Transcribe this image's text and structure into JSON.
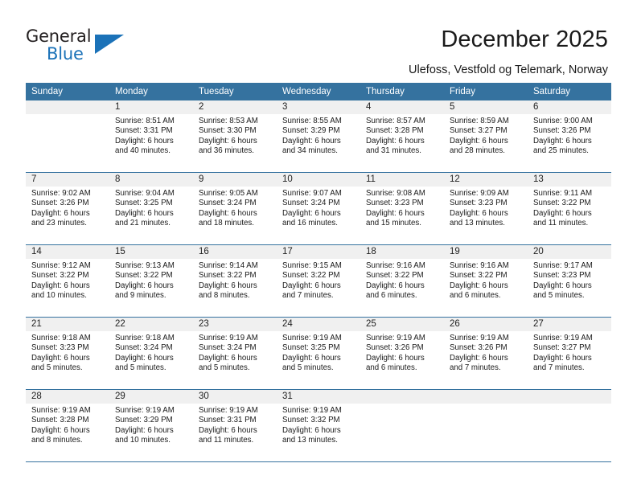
{
  "brand": {
    "name_top": "General",
    "name_bottom": "Blue",
    "accent_color": "#1b72b8",
    "triangle_icon": "triangle-icon"
  },
  "header": {
    "title": "December 2025",
    "subtitle": "Ulefoss, Vestfold og Telemark, Norway"
  },
  "calendar": {
    "header_bg": "#35729f",
    "daynum_bg": "#f0f0f0",
    "weekdays": [
      "Sunday",
      "Monday",
      "Tuesday",
      "Wednesday",
      "Thursday",
      "Friday",
      "Saturday"
    ],
    "weeks": [
      [
        {
          "day": "",
          "sunrise": "",
          "sunset": "",
          "daylight_line1": "",
          "daylight_line2": ""
        },
        {
          "day": "1",
          "sunrise": "Sunrise: 8:51 AM",
          "sunset": "Sunset: 3:31 PM",
          "daylight_line1": "Daylight: 6 hours",
          "daylight_line2": "and 40 minutes."
        },
        {
          "day": "2",
          "sunrise": "Sunrise: 8:53 AM",
          "sunset": "Sunset: 3:30 PM",
          "daylight_line1": "Daylight: 6 hours",
          "daylight_line2": "and 36 minutes."
        },
        {
          "day": "3",
          "sunrise": "Sunrise: 8:55 AM",
          "sunset": "Sunset: 3:29 PM",
          "daylight_line1": "Daylight: 6 hours",
          "daylight_line2": "and 34 minutes."
        },
        {
          "day": "4",
          "sunrise": "Sunrise: 8:57 AM",
          "sunset": "Sunset: 3:28 PM",
          "daylight_line1": "Daylight: 6 hours",
          "daylight_line2": "and 31 minutes."
        },
        {
          "day": "5",
          "sunrise": "Sunrise: 8:59 AM",
          "sunset": "Sunset: 3:27 PM",
          "daylight_line1": "Daylight: 6 hours",
          "daylight_line2": "and 28 minutes."
        },
        {
          "day": "6",
          "sunrise": "Sunrise: 9:00 AM",
          "sunset": "Sunset: 3:26 PM",
          "daylight_line1": "Daylight: 6 hours",
          "daylight_line2": "and 25 minutes."
        }
      ],
      [
        {
          "day": "7",
          "sunrise": "Sunrise: 9:02 AM",
          "sunset": "Sunset: 3:26 PM",
          "daylight_line1": "Daylight: 6 hours",
          "daylight_line2": "and 23 minutes."
        },
        {
          "day": "8",
          "sunrise": "Sunrise: 9:04 AM",
          "sunset": "Sunset: 3:25 PM",
          "daylight_line1": "Daylight: 6 hours",
          "daylight_line2": "and 21 minutes."
        },
        {
          "day": "9",
          "sunrise": "Sunrise: 9:05 AM",
          "sunset": "Sunset: 3:24 PM",
          "daylight_line1": "Daylight: 6 hours",
          "daylight_line2": "and 18 minutes."
        },
        {
          "day": "10",
          "sunrise": "Sunrise: 9:07 AM",
          "sunset": "Sunset: 3:24 PM",
          "daylight_line1": "Daylight: 6 hours",
          "daylight_line2": "and 16 minutes."
        },
        {
          "day": "11",
          "sunrise": "Sunrise: 9:08 AM",
          "sunset": "Sunset: 3:23 PM",
          "daylight_line1": "Daylight: 6 hours",
          "daylight_line2": "and 15 minutes."
        },
        {
          "day": "12",
          "sunrise": "Sunrise: 9:09 AM",
          "sunset": "Sunset: 3:23 PM",
          "daylight_line1": "Daylight: 6 hours",
          "daylight_line2": "and 13 minutes."
        },
        {
          "day": "13",
          "sunrise": "Sunrise: 9:11 AM",
          "sunset": "Sunset: 3:22 PM",
          "daylight_line1": "Daylight: 6 hours",
          "daylight_line2": "and 11 minutes."
        }
      ],
      [
        {
          "day": "14",
          "sunrise": "Sunrise: 9:12 AM",
          "sunset": "Sunset: 3:22 PM",
          "daylight_line1": "Daylight: 6 hours",
          "daylight_line2": "and 10 minutes."
        },
        {
          "day": "15",
          "sunrise": "Sunrise: 9:13 AM",
          "sunset": "Sunset: 3:22 PM",
          "daylight_line1": "Daylight: 6 hours",
          "daylight_line2": "and 9 minutes."
        },
        {
          "day": "16",
          "sunrise": "Sunrise: 9:14 AM",
          "sunset": "Sunset: 3:22 PM",
          "daylight_line1": "Daylight: 6 hours",
          "daylight_line2": "and 8 minutes."
        },
        {
          "day": "17",
          "sunrise": "Sunrise: 9:15 AM",
          "sunset": "Sunset: 3:22 PM",
          "daylight_line1": "Daylight: 6 hours",
          "daylight_line2": "and 7 minutes."
        },
        {
          "day": "18",
          "sunrise": "Sunrise: 9:16 AM",
          "sunset": "Sunset: 3:22 PM",
          "daylight_line1": "Daylight: 6 hours",
          "daylight_line2": "and 6 minutes."
        },
        {
          "day": "19",
          "sunrise": "Sunrise: 9:16 AM",
          "sunset": "Sunset: 3:22 PM",
          "daylight_line1": "Daylight: 6 hours",
          "daylight_line2": "and 6 minutes."
        },
        {
          "day": "20",
          "sunrise": "Sunrise: 9:17 AM",
          "sunset": "Sunset: 3:23 PM",
          "daylight_line1": "Daylight: 6 hours",
          "daylight_line2": "and 5 minutes."
        }
      ],
      [
        {
          "day": "21",
          "sunrise": "Sunrise: 9:18 AM",
          "sunset": "Sunset: 3:23 PM",
          "daylight_line1": "Daylight: 6 hours",
          "daylight_line2": "and 5 minutes."
        },
        {
          "day": "22",
          "sunrise": "Sunrise: 9:18 AM",
          "sunset": "Sunset: 3:24 PM",
          "daylight_line1": "Daylight: 6 hours",
          "daylight_line2": "and 5 minutes."
        },
        {
          "day": "23",
          "sunrise": "Sunrise: 9:19 AM",
          "sunset": "Sunset: 3:24 PM",
          "daylight_line1": "Daylight: 6 hours",
          "daylight_line2": "and 5 minutes."
        },
        {
          "day": "24",
          "sunrise": "Sunrise: 9:19 AM",
          "sunset": "Sunset: 3:25 PM",
          "daylight_line1": "Daylight: 6 hours",
          "daylight_line2": "and 5 minutes."
        },
        {
          "day": "25",
          "sunrise": "Sunrise: 9:19 AM",
          "sunset": "Sunset: 3:26 PM",
          "daylight_line1": "Daylight: 6 hours",
          "daylight_line2": "and 6 minutes."
        },
        {
          "day": "26",
          "sunrise": "Sunrise: 9:19 AM",
          "sunset": "Sunset: 3:26 PM",
          "daylight_line1": "Daylight: 6 hours",
          "daylight_line2": "and 7 minutes."
        },
        {
          "day": "27",
          "sunrise": "Sunrise: 9:19 AM",
          "sunset": "Sunset: 3:27 PM",
          "daylight_line1": "Daylight: 6 hours",
          "daylight_line2": "and 7 minutes."
        }
      ],
      [
        {
          "day": "28",
          "sunrise": "Sunrise: 9:19 AM",
          "sunset": "Sunset: 3:28 PM",
          "daylight_line1": "Daylight: 6 hours",
          "daylight_line2": "and 8 minutes."
        },
        {
          "day": "29",
          "sunrise": "Sunrise: 9:19 AM",
          "sunset": "Sunset: 3:29 PM",
          "daylight_line1": "Daylight: 6 hours",
          "daylight_line2": "and 10 minutes."
        },
        {
          "day": "30",
          "sunrise": "Sunrise: 9:19 AM",
          "sunset": "Sunset: 3:31 PM",
          "daylight_line1": "Daylight: 6 hours",
          "daylight_line2": "and 11 minutes."
        },
        {
          "day": "31",
          "sunrise": "Sunrise: 9:19 AM",
          "sunset": "Sunset: 3:32 PM",
          "daylight_line1": "Daylight: 6 hours",
          "daylight_line2": "and 13 minutes."
        },
        {
          "day": "",
          "sunrise": "",
          "sunset": "",
          "daylight_line1": "",
          "daylight_line2": ""
        },
        {
          "day": "",
          "sunrise": "",
          "sunset": "",
          "daylight_line1": "",
          "daylight_line2": ""
        },
        {
          "day": "",
          "sunrise": "",
          "sunset": "",
          "daylight_line1": "",
          "daylight_line2": ""
        }
      ]
    ]
  }
}
